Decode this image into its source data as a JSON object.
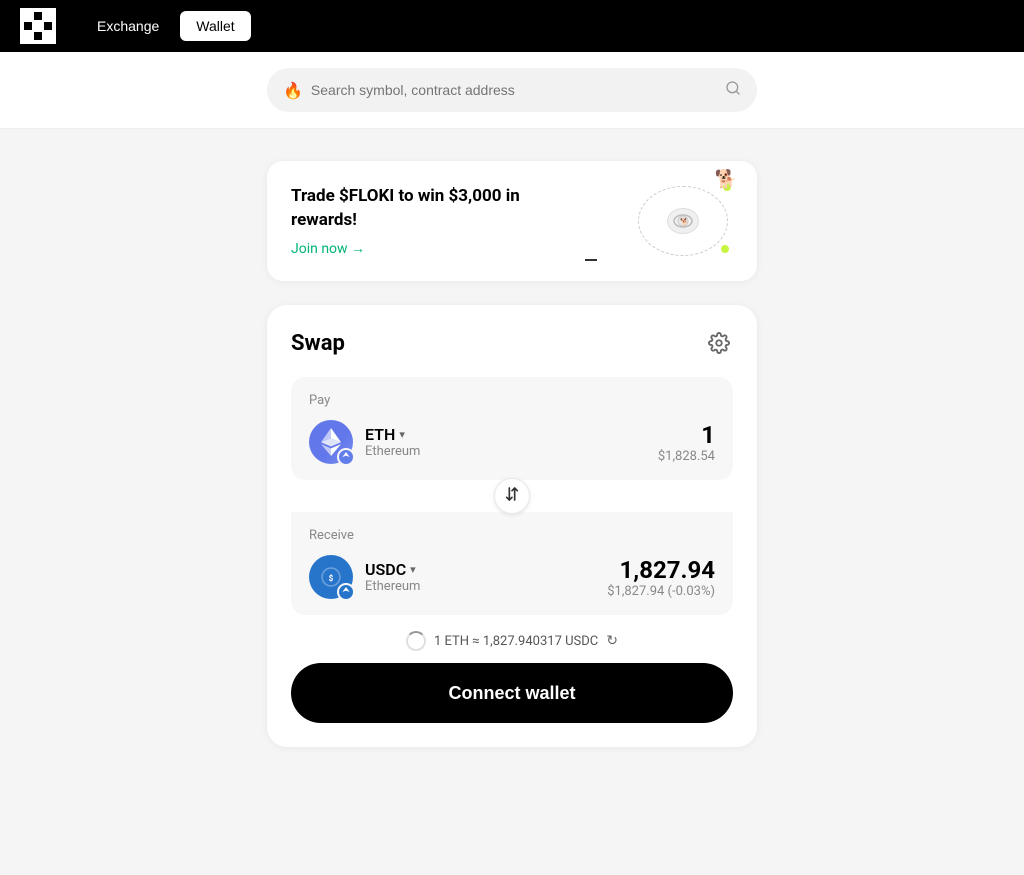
{
  "header": {
    "logo_alt": "OKX Logo",
    "tabs": [
      {
        "id": "exchange",
        "label": "Exchange",
        "active": false
      },
      {
        "id": "wallet",
        "label": "Wallet",
        "active": true
      }
    ]
  },
  "search": {
    "placeholder": "Search symbol, contract address",
    "icon": "fire-icon"
  },
  "promo": {
    "headline": "Trade $FLOKI to win $3,000 in rewards!",
    "cta_label": "Join now →",
    "illustration_emoji": "🐶"
  },
  "swap": {
    "title": "Swap",
    "settings_icon": "gear-icon",
    "pay": {
      "label": "Pay",
      "token": "ETH",
      "token_full": "Ethereum",
      "amount": "1",
      "amount_usd": "$1,828.54"
    },
    "receive": {
      "label": "Receive",
      "token": "USDC",
      "token_full": "Ethereum",
      "amount": "1,827.94",
      "amount_usd": "$1,827.94 (-0.03%)"
    },
    "rate": "1 ETH ≈ 1,827.940317 USDC",
    "connect_wallet_label": "Connect wallet"
  }
}
